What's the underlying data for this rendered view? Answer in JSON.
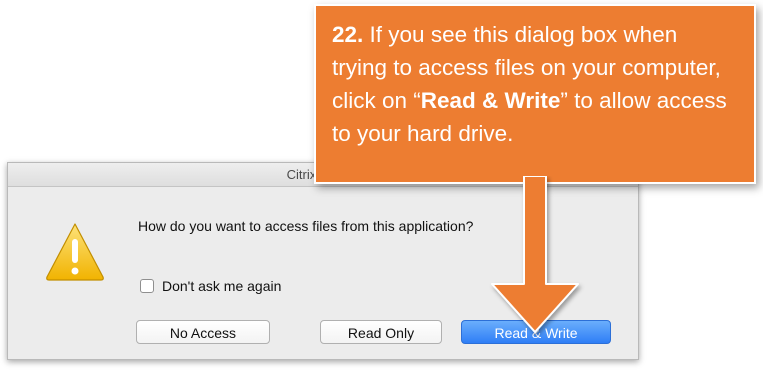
{
  "dialog": {
    "title": "Citrix Viewer",
    "message": "How do you want to access files from this application?",
    "checkbox_label": "Don't ask me again",
    "checkbox_checked": false,
    "buttons": {
      "no_access": "No Access",
      "read_only": "Read Only",
      "read_write": "Read & Write"
    },
    "icon": "warning-icon",
    "accent_color": "#2f7ef6"
  },
  "callout": {
    "step": "22.",
    "text_1": " If you see this dialog box when trying to access files on your computer, click on “",
    "highlight": "Read & Write",
    "text_2": "” to allow access to your hard drive.",
    "color": "#ed7d31"
  }
}
